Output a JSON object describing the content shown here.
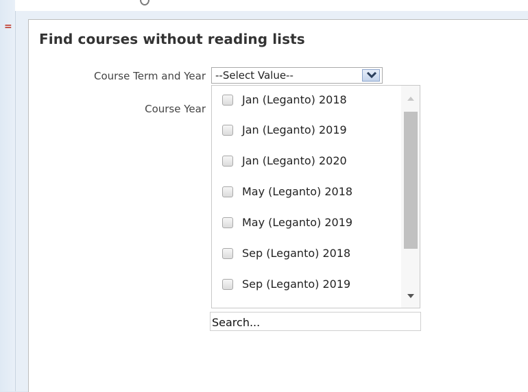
{
  "card": {
    "title": "Find courses without reading lists"
  },
  "fields": {
    "term_label": "Course Term and Year",
    "year_label": "Course Year",
    "term_select_value": "--Select Value--"
  },
  "dropdown": {
    "options": [
      {
        "label": "Jan (Leganto) 2018",
        "checked": false
      },
      {
        "label": "Jan (Leganto) 2019",
        "checked": false
      },
      {
        "label": "Jan (Leganto) 2020",
        "checked": false
      },
      {
        "label": "May (Leganto) 2018",
        "checked": false
      },
      {
        "label": "May (Leganto) 2019",
        "checked": false
      },
      {
        "label": "Sep (Leganto) 2018",
        "checked": false
      },
      {
        "label": "Sep (Leganto) 2019",
        "checked": false
      }
    ],
    "search_placeholder": "Search..."
  },
  "colors": {
    "arrow_icon": "#2b3f5c",
    "scroll_thumb": "#c1c1c1"
  }
}
